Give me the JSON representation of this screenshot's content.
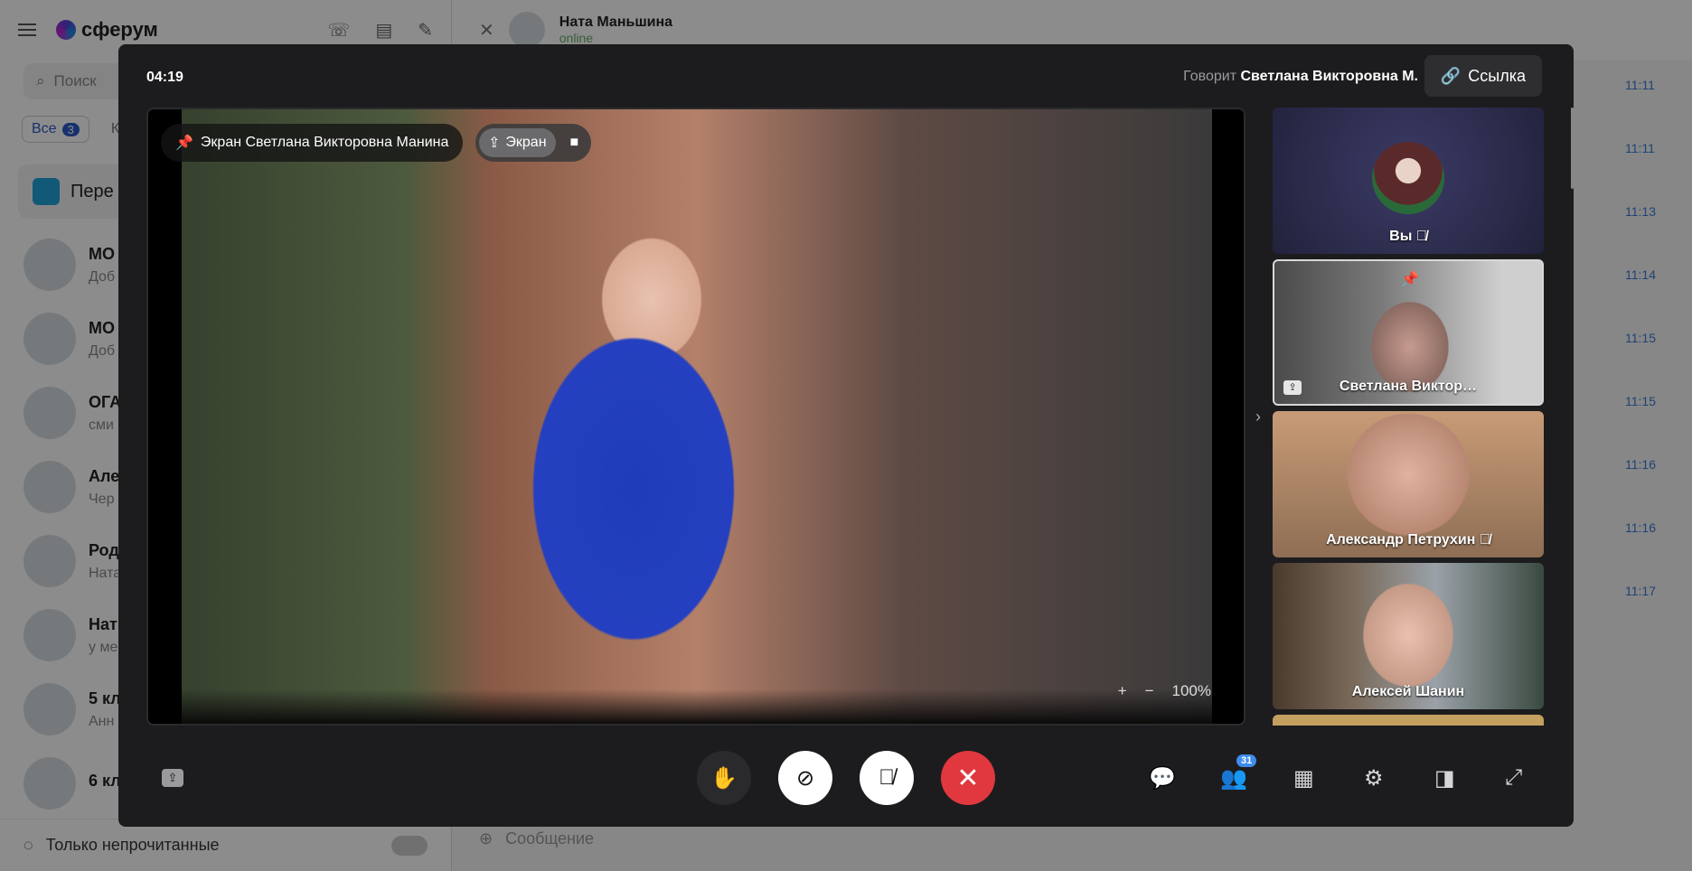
{
  "app": {
    "logo_text": "сферум",
    "search_placeholder": "Поиск",
    "filters": [
      {
        "label": "Все",
        "count": "3"
      },
      {
        "label": "К"
      }
    ],
    "pinned_label": "Пере",
    "chats": [
      {
        "title": "МО",
        "sub": "Доб"
      },
      {
        "title": "МО",
        "sub": "Доб"
      },
      {
        "title": "ОГА",
        "sub": "сми"
      },
      {
        "title": "Але",
        "sub": "Чер"
      },
      {
        "title": "Род",
        "sub": "Ната"
      },
      {
        "title": "Нат",
        "sub": "у ме"
      },
      {
        "title": "5 кл",
        "sub": "Анн"
      },
      {
        "title": "6 кл",
        "sub": ""
      }
    ],
    "unread_only_label": "Только непрочитанные",
    "chat_header": {
      "name": "Ната Маньшина",
      "status": "online"
    },
    "message_times": [
      "11:11",
      "11:11",
      "11:13",
      "11:14",
      "11:15",
      "11:15",
      "11:16",
      "11:16",
      "11:17"
    ],
    "compose_placeholder": "Сообщение"
  },
  "call": {
    "timer": "04:19",
    "speaking_prefix": "Говорит",
    "speaking_name": "Светлана Викторовна М.",
    "link_label": "Ссылка",
    "pinned_label": "Экран Светлана Викторовна Манина",
    "mode_screen_label": "Экран",
    "zoom_label": "100%",
    "tiles": [
      {
        "label": "Вы"
      },
      {
        "label": "Светлана Виктор…"
      },
      {
        "label": "Александр Петрухин"
      },
      {
        "label": "Алексей Шанин"
      }
    ],
    "participants_count": "31"
  },
  "colors": {
    "end_call": "#e0383e",
    "badge": "#3f8cf0",
    "modal_bg": "#1c1c1e"
  }
}
